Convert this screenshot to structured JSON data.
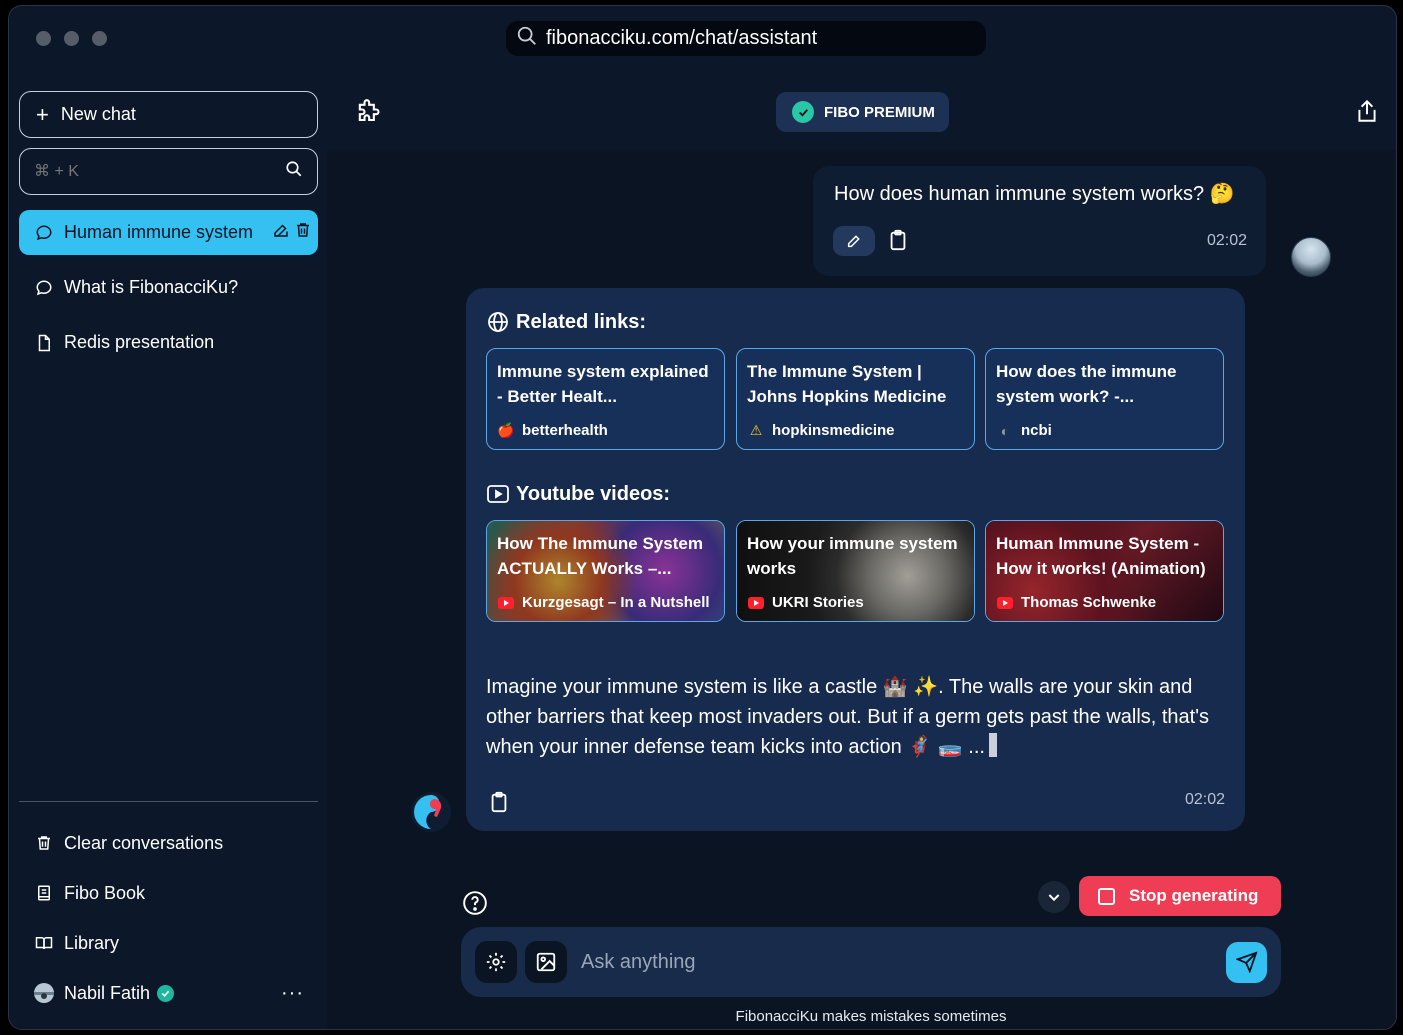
{
  "browser": {
    "url": "fibonacciku.com/chat/assistant"
  },
  "sidebar": {
    "new_chat_label": "New chat",
    "search_placeholder": "⌘ + K",
    "conversations": [
      {
        "label": "Human immune system",
        "icon": "chat-bubble-icon",
        "active": true
      },
      {
        "label": "What is FibonacciKu?",
        "icon": "chat-bubble-icon",
        "active": false
      },
      {
        "label": "Redis presentation",
        "icon": "document-icon",
        "active": false
      }
    ],
    "bottom": {
      "clear_label": "Clear conversations",
      "book_label": "Fibo Book",
      "library_label": "Library",
      "user_name": "Nabil Fatih",
      "more_label": "···"
    }
  },
  "header": {
    "badge_label": "FIBO PREMIUM"
  },
  "chat": {
    "user_message": {
      "text": "How does human immune system works? 🤔",
      "time": "02:02"
    },
    "assistant_message": {
      "related_links_title": "Related links:",
      "links": [
        {
          "title": "Immune system explained - Better Healt...",
          "source": "betterhealth",
          "source_icon": "🍎"
        },
        {
          "title": "The Immune System | Johns Hopkins Medicine",
          "source": "hopkinsmedicine",
          "source_icon": "⚠"
        },
        {
          "title": "How does the immune system work? -...",
          "source": "ncbi",
          "source_icon": "◐"
        }
      ],
      "videos_title": "Youtube videos:",
      "videos": [
        {
          "title": "How The Immune System ACTUALLY Works –...",
          "channel": "Kurzgesagt – In a Nutshell"
        },
        {
          "title": "How your immune system works",
          "channel": "UKRI Stories"
        },
        {
          "title": "Human Immune System - How it works! (Animation)",
          "channel": "Thomas Schwenke"
        }
      ],
      "answer_text": "Imagine your immune system is like a castle 🏰 ✨. The walls are your skin and other barriers that keep most invaders out. But if a germ gets past the walls, that's when your inner defense team kicks into action 🦸 🧫 ...",
      "time": "02:02"
    }
  },
  "controls": {
    "stop_label": "Stop generating",
    "input_placeholder": "Ask anything",
    "disclaimer": "FibonacciKu makes mistakes sometimes"
  },
  "colors": {
    "accent": "#34c1f1",
    "stop": "#ef3d55",
    "premium": "#2ac7a5"
  }
}
